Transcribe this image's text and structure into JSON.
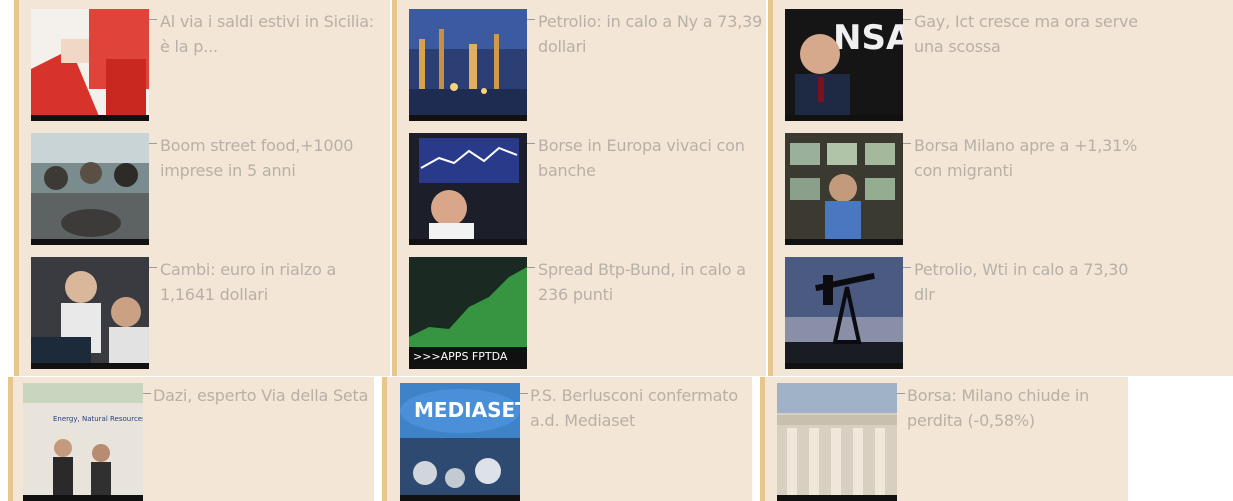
{
  "news_rows": [
    {
      "items": [
        {
          "title": "Al via i saldi estivi in Sicilia: è la p...",
          "thumb": "shopping-bags-icon"
        },
        {
          "title": "Boom street food,+1000 imprese in 5 anni",
          "thumb": "street-food-crowd-icon"
        },
        {
          "title": "Cambi: euro in rialzo a 1,1641 dollari",
          "thumb": "traders-icon"
        }
      ]
    },
    {
      "items": [
        {
          "title": "Petrolio: in calo a Ny a 73,39 dollari",
          "thumb": "refinery-icon"
        },
        {
          "title": "Borse in Europa vivaci con banche",
          "thumb": "trader-screen-icon"
        },
        {
          "title": "Spread Btp-Bund, in calo a 236 punti",
          "thumb": "stock-ticker-icon"
        }
      ]
    },
    {
      "items": [
        {
          "title": "Gay, Ict cresce ma ora serve una scossa",
          "thumb": "speaker-ansa-icon"
        },
        {
          "title": "Borsa Milano apre a +1,31% con migranti",
          "thumb": "trading-desk-icon"
        },
        {
          "title": "Petrolio, Wti in calo a 73,30 dlr",
          "thumb": "oil-pump-icon"
        }
      ]
    }
  ],
  "bottom_row": [
    {
      "title": "Dazi, esperto Via della Seta",
      "thumb": "conference-icon"
    },
    {
      "title": "P.S. Berlusconi confermato a.d. Mediaset",
      "thumb": "mediaset-tower-icon"
    },
    {
      "title": "Borsa: Milano chiude in perdita (-0,58%)",
      "thumb": "stock-exchange-building-icon"
    }
  ],
  "colors": {
    "panel": "#f3e6d6",
    "accent": "#e8c78f",
    "text": "#b8b0a6"
  }
}
